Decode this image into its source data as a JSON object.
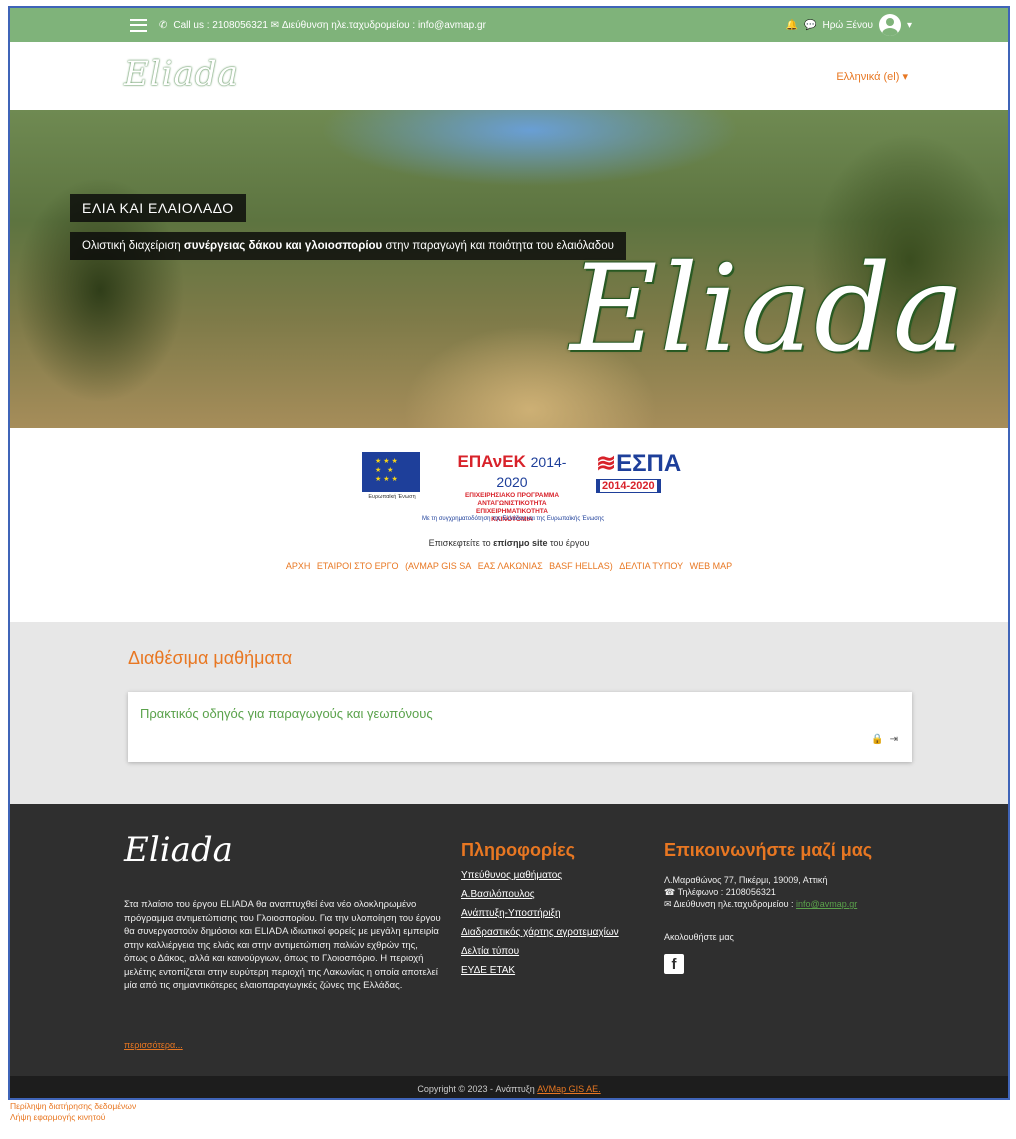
{
  "topbar": {
    "contact_text": "Call us : 2108056321 ✉ Διεύθυνση ηλε.ταχυδρομείου : info@avmap.gr",
    "user_name": "Ηρώ Ξένου"
  },
  "header": {
    "logo_text": "Eliada",
    "language": "Ελληνικά (el) ▾"
  },
  "hero": {
    "title": "ΕΛΙΑ ΚΑΙ ΕΛΑΙΟΛΑΔΟ",
    "subtitle_pre": "Ολιστική διαχείριση ",
    "subtitle_bold": "συνέργειας δάκου και γλοιοσπορίου",
    "subtitle_post": " στην παραγωγή και ποιότητα του ελαιόλαδου",
    "logo_text": "Eliada"
  },
  "sponsors": {
    "eu_caption": "Ευρωπαϊκή Ένωση",
    "epanek_title": "ΕΠΑνΕΚ",
    "epanek_years": "2014-2020",
    "epanek_line1": "ΕΠΙΧΕΙΡΗΣΙΑΚΟ ΠΡΟΓΡΑΜΜΑ",
    "epanek_line2": "ΑΝΤΑΓΩΝΙΣΤΙΚΟΤΗΤΑ",
    "epanek_line3": "ΕΠΙΧΕΙΡΗΜΑΤΙΚΟΤΗΤΑ",
    "epanek_line4": "ΚΑΙΝΟΤΟΜΙΑ",
    "espa_title": "ΕΣΠΑ",
    "espa_years": "2014-2020",
    "cofund": "Με τη συγχρηματοδότηση της Ελλάδας και της Ευρωπαϊκής Ένωσης"
  },
  "visit": {
    "pre": "Επισκεφτείτε το ",
    "bold": "επίσημο site",
    "post": " του έργου"
  },
  "navlinks": [
    "ΑΡΧΗ",
    "ΕΤΑΙΡΟΙ ΣΤΟ ΕΡΓΟ",
    "(AVMAP GIS SA",
    "ΕΑΣ ΛΑΚΩΝΙΑΣ",
    "BASF HELLAS)",
    "ΔΕΛΤΙΑ ΤΥΠΟΥ",
    "WEB MAP"
  ],
  "courses": {
    "heading": "Διαθέσιμα μαθήματα",
    "items": [
      {
        "name": "Πρακτικός οδηγός για παραγωγούς και γεωπόνους"
      }
    ]
  },
  "footer": {
    "logo_text": "Eliada",
    "about": "Στα πλαίσιο του έργου ELIADA θα αναπτυχθεί ένα νέο ολοκληρωμένο πρόγραμμα αντιμετώπισης του Γλοιοσπορίου. Για την υλοποίηση του έργου θα συνεργαστούν δημόσιοι και ELIADA ιδιωτικοί φορείς με μεγάλη εμπειρία στην καλλιέργεια της ελιάς και στην αντιμετώπιση παλιών εχθρών της, όπως ο Δάκος, αλλά και καινούργιων, όπως το Γλοιοσπόριο. Η περιοχή μελέτης εντοπίζεται στην ευρύτερη περιοχή της Λακωνίας η οποία αποτελεί μία από τις σημαντικότερες ελαιοπαραγωγικές ζώνες της Ελλάδας.",
    "more": "περισσότερα...",
    "info_title": "Πληροφορίες",
    "info_links": [
      "Υπεύθυνος μαθήματος",
      "Α.Βασιλόπουλος",
      "Ανάπτυξη-Υποστήριξη",
      "Διαδραστικός χάρτης αγροτεμαχίων",
      "Δελτία τύπου",
      "ΕΥΔΕ ΕΤΑΚ"
    ],
    "contact_title": "Επικοινωνήστε μαζί μας",
    "address": "Λ.Μαραθώνος 77, Πικέρμι, 19009, Αττική",
    "phone": "Τηλέφωνο : 2108056321",
    "email_label": "Διεύθυνση ηλε.ταχυδρομείου : ",
    "email": "info@avmap.gr",
    "follow": "Ακολουθήστε μας",
    "facebook_glyph": "f"
  },
  "copyright": {
    "text": "Copyright © 2023 - Ανάπτυξη ",
    "company": "AVMap GIS AE."
  },
  "below": {
    "line1": "Περίληψη διατήρησης δεδομένων",
    "line2": "Λήψη εφαρμογής κινητού"
  },
  "colors": {
    "green_bar": "#7fb37a",
    "accent_orange": "#e87722",
    "footer_bg": "#2f2f2f",
    "course_link": "#5aa24b"
  }
}
